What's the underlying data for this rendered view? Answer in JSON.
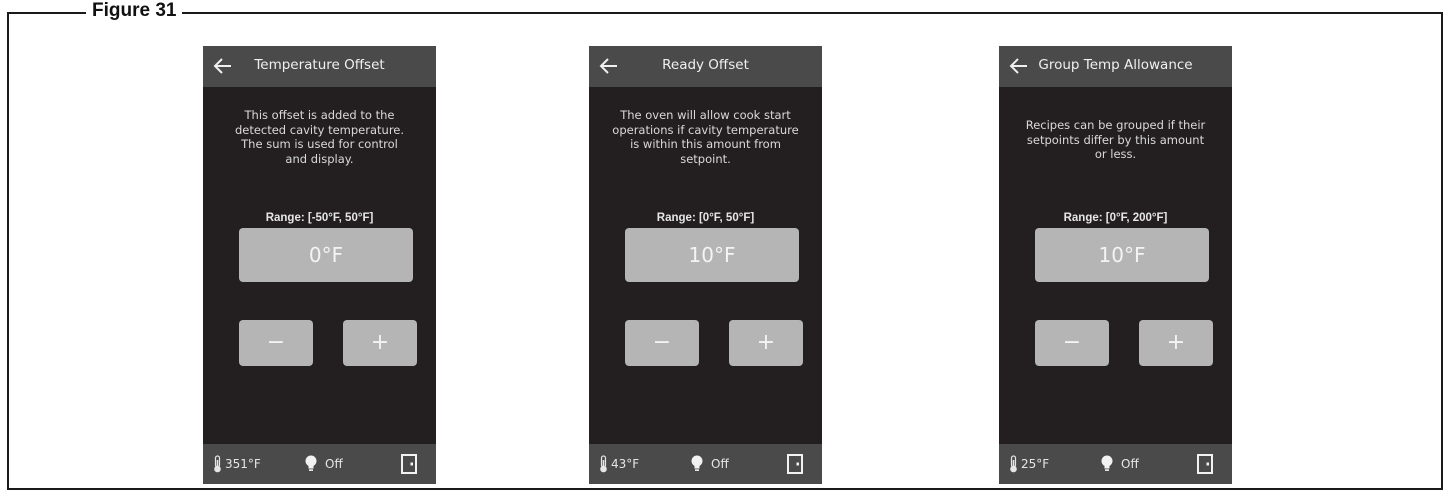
{
  "figure": {
    "label": "Figure 31"
  },
  "screens": [
    {
      "title": "Temperature Offset",
      "description_lines": [
        "This offset is added to the",
        "detected cavity temperature.",
        "The sum is used for control",
        "and display."
      ],
      "range": "Range: [-50°F, 50°F]",
      "value": "0°F",
      "minus_label": "−",
      "plus_label": "+",
      "footer": {
        "temperature": "351°F",
        "light_status": "Off"
      }
    },
    {
      "title": "Ready Offset",
      "description_lines": [
        "The oven will allow cook start",
        "operations if cavity temperature",
        "is within this amount from",
        "setpoint."
      ],
      "range": "Range: [0°F, 50°F]",
      "value": "10°F",
      "minus_label": "−",
      "plus_label": "+",
      "footer": {
        "temperature": "43°F",
        "light_status": "Off"
      }
    },
    {
      "title": "Group Temp Allowance",
      "description_lines": [
        "Recipes can be grouped if their",
        "setpoints differ by this amount",
        "or less."
      ],
      "range": "Range: [0°F, 200°F]",
      "value": "10°F",
      "minus_label": "−",
      "plus_label": "+",
      "footer": {
        "temperature": "25°F",
        "light_status": "Off"
      }
    }
  ],
  "icons": [
    "back-arrow-icon",
    "thermometer-icon",
    "light-bulb-icon",
    "door-icon"
  ],
  "colors": {
    "screen_bg": "#231f20",
    "bar_bg": "#4a4a4a",
    "control_bg": "#b5b5b5"
  }
}
